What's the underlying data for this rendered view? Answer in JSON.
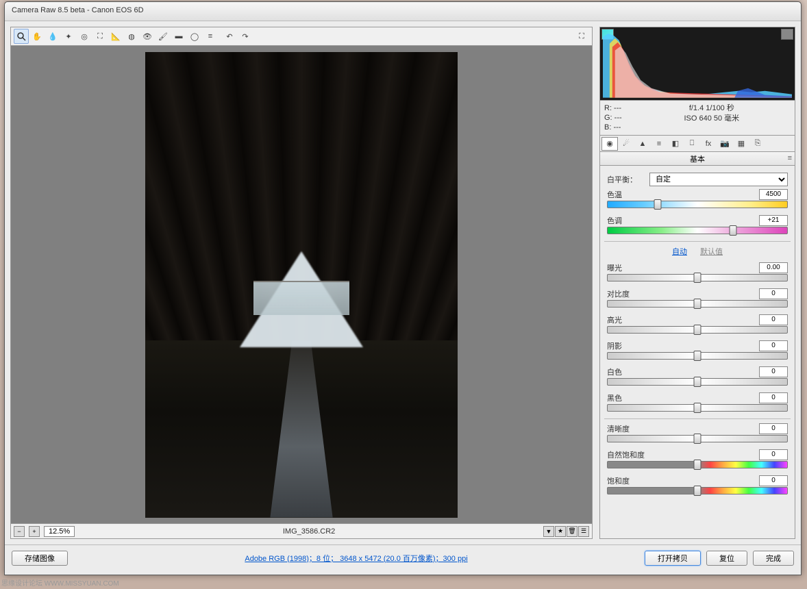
{
  "title": "Camera Raw 8.5 beta  -  Canon EOS 6D",
  "toolbar_icons": [
    "zoom",
    "hand",
    "eyedropper",
    "sampler",
    "target",
    "crop",
    "straighten",
    "spot",
    "redeye",
    "brush",
    "grad",
    "radial",
    "prefs",
    "rotate-ccw",
    "rotate-cw"
  ],
  "zoom": "12.5%",
  "filename": "IMG_3586.CR2",
  "meta": {
    "r": "R:  ---",
    "g": "G:  ---",
    "b": "B:  ---",
    "line1": "f/1.4  1/100 秒",
    "line2": "ISO 640  50 毫米"
  },
  "panel_tabs": [
    "basic",
    "curve",
    "detail",
    "hsl",
    "split",
    "lens",
    "fx",
    "camera",
    "presets",
    "snapshots"
  ],
  "panel_title": "基本",
  "wb": {
    "label": "白平衡：",
    "value": "自定"
  },
  "sliders": {
    "temp": {
      "label": "色温",
      "value": "4500",
      "pos": 28
    },
    "tint": {
      "label": "色调",
      "value": "+21",
      "pos": 70
    },
    "exposure": {
      "label": "曝光",
      "value": "0.00",
      "pos": 50
    },
    "contrast": {
      "label": "对比度",
      "value": "0",
      "pos": 50
    },
    "highlights": {
      "label": "高光",
      "value": "0",
      "pos": 50
    },
    "shadows": {
      "label": "阴影",
      "value": "0",
      "pos": 50
    },
    "whites": {
      "label": "白色",
      "value": "0",
      "pos": 50
    },
    "blacks": {
      "label": "黑色",
      "value": "0",
      "pos": 50
    },
    "clarity": {
      "label": "清晰度",
      "value": "0",
      "pos": 50
    },
    "vibrance": {
      "label": "自然饱和度",
      "value": "0",
      "pos": 50
    },
    "saturation": {
      "label": "饱和度",
      "value": "0",
      "pos": 50
    }
  },
  "links": {
    "auto": "自动",
    "default": "默认值"
  },
  "buttons": {
    "save": "存储图像",
    "open": "打开拷贝",
    "reset": "复位",
    "done": "完成"
  },
  "profile_link": "Adobe RGB (1998)；8 位； 3648 x 5472 (20.0 百万像素)；300 ppi",
  "watermark": "思缘设计论坛  WWW.MISSYUAN.COM"
}
